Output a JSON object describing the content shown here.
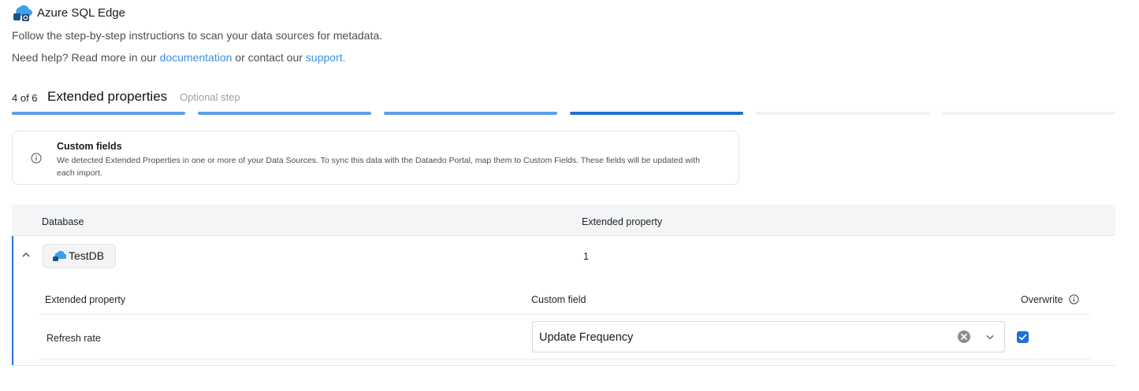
{
  "header": {
    "title": "Azure SQL Edge",
    "intro": "Follow the step-by-step instructions to scan your data sources for metadata.",
    "help_prefix": "Need help? Read more in our ",
    "help_doc_link": "documentation",
    "help_middle": " or contact our ",
    "help_support_link": "support."
  },
  "step": {
    "count": "4 of 6",
    "title": "Extended properties",
    "optional": "Optional step",
    "total": 6,
    "current": 4
  },
  "info": {
    "title": "Custom fields",
    "text": "We detected Extended Properties in one or more of your Data Sources. To sync this data with the Dataedo Portal, map them to Custom Fields. These fields will be updated with each import."
  },
  "table": {
    "columns": [
      "Database",
      "Extended property"
    ],
    "rows": [
      {
        "database": "TestDB",
        "extended_property_count": "1",
        "expanded": true,
        "sub_columns": [
          "Extended property",
          "Custom field",
          "Overwrite"
        ],
        "mappings": [
          {
            "property": "Refresh rate",
            "custom_field": "Update Frequency",
            "overwrite": true
          }
        ]
      }
    ]
  },
  "colors": {
    "link": "#3b8fe0",
    "accent": "#1f6fd6",
    "progress_done": "#5b9ee8",
    "progress_todo": "#f1f2f4"
  },
  "icons": {
    "app": "azure-sql-edge-icon",
    "info": "info-circle-icon",
    "collapse": "chevron-up-icon",
    "database": "database-cloud-icon",
    "clear": "clear-circle-icon",
    "dropdown": "chevron-down-icon",
    "checkbox": "check-icon"
  }
}
